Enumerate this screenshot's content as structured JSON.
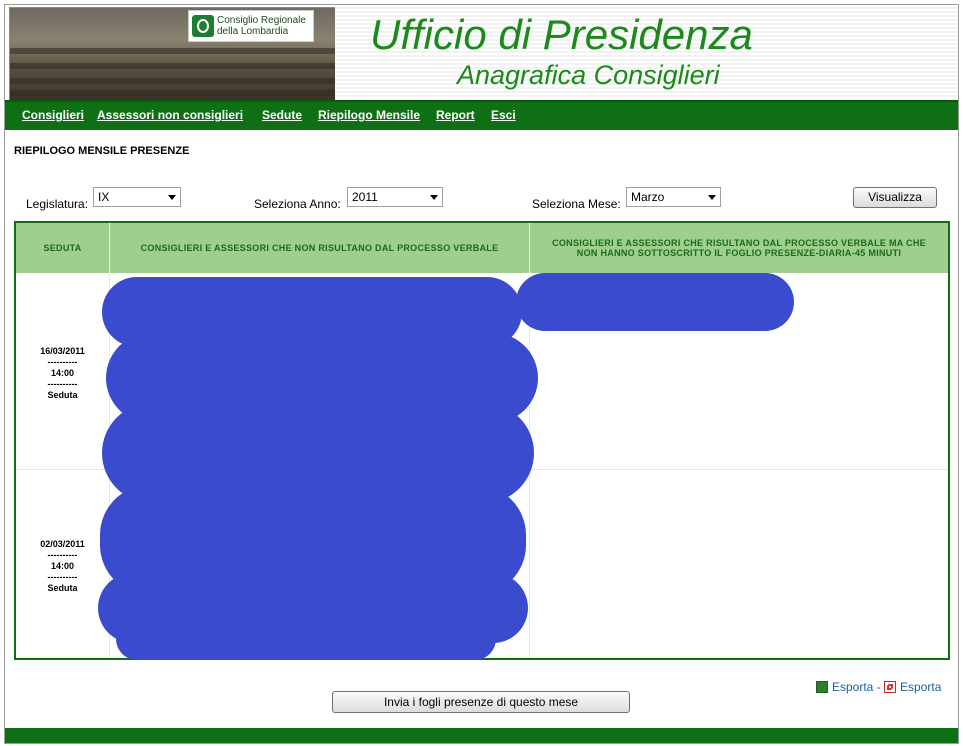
{
  "header": {
    "logo_line1": "Consiglio Regionale",
    "logo_line2": "della Lombardia",
    "title": "Ufficio di Presidenza",
    "subtitle": "Anagrafica Consiglieri"
  },
  "nav": {
    "items": [
      "Consiglieri",
      "Assessori non consiglieri",
      "Sedute",
      "Riepilogo Mensile",
      "Report",
      "Esci"
    ]
  },
  "page": {
    "title": "RIEPILOGO MENSILE PRESENZE"
  },
  "filters": {
    "legislatura_label": "Legislatura:",
    "legislatura_value": "IX",
    "anno_label": "Seleziona Anno:",
    "anno_value": "2011",
    "mese_label": "Seleziona Mese:",
    "mese_value": "Marzo",
    "visualizza_label": "Visualizza"
  },
  "table": {
    "col1": "SEDUTA",
    "col2": "CONSIGLIERI E ASSESSORI CHE NON RISULTANO DAL PROCESSO VERBALE",
    "col3": "CONSIGLIERI E ASSESSORI CHE RISULTANO DAL PROCESSO VERBALE MA CHE NON HANNO SOTTOSCRITTO IL FOGLIO PRESENZE-DIARIA-45 MINUTI",
    "rows": [
      {
        "date": "16/03/2011",
        "sep1": "----------",
        "time": "14:00",
        "sep2": "----------",
        "type": "Seduta"
      },
      {
        "date": "02/03/2011",
        "sep1": "----------",
        "time": "14:00",
        "sep2": "----------",
        "type": "Seduta"
      }
    ]
  },
  "exports": {
    "excel_label": "Esporta",
    "separator": "-",
    "pdf_label": "Esporta"
  },
  "send_button": "Invia i fogli presenze di questo mese",
  "colors": {
    "nav_green": "#0f6f14",
    "header_green": "#9ecf8f",
    "title_green": "#1a8a1a",
    "redaction_blue": "#3b4bcd"
  }
}
